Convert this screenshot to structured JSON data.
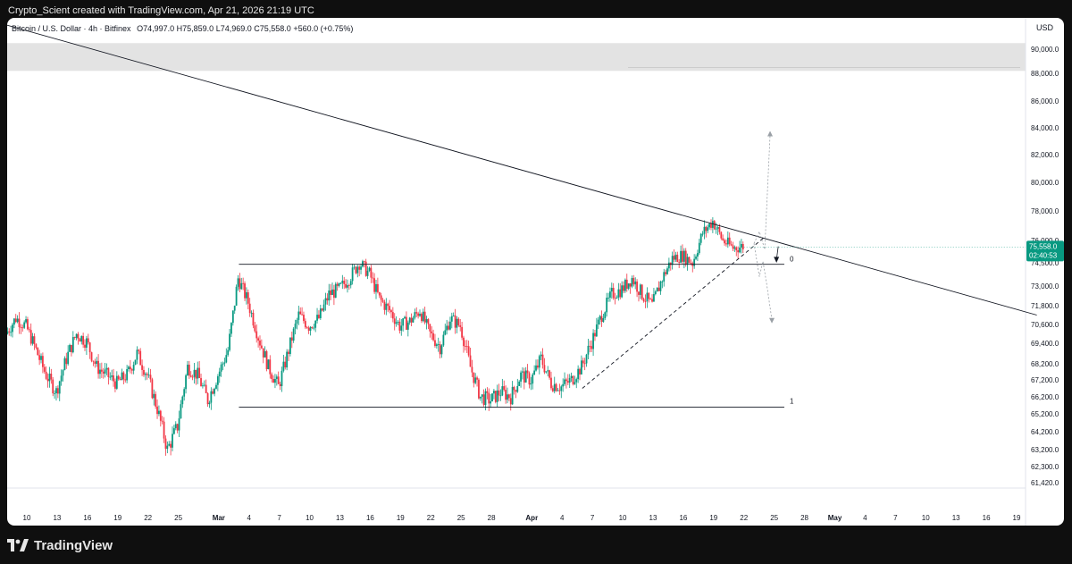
{
  "header": {
    "attribution": "Crypto_Scient created with TradingView.com, Apr 21, 2026 21:19 UTC"
  },
  "legend": {
    "symbol": "Bitcoin / U.S. Dollar · 4h · Bitfinex",
    "open": "O74,997.0",
    "high": "H75,859.0",
    "low": "L74,969.0",
    "close": "C75,558.0",
    "change": "+560.0 (+0.75%)"
  },
  "currency_label": "USD",
  "price_tag": {
    "price": "75,558.0",
    "countdown": "02:40:53",
    "color": "#089981"
  },
  "footer": {
    "brand": "TradingView"
  },
  "colors": {
    "up": "#089981",
    "down": "#f23645",
    "line": "#131722",
    "band": "#e3e3e3"
  },
  "chart_data": {
    "type": "candlestick",
    "timeframe": "4h",
    "y_ticks": [
      "90,000.0",
      "88,000.0",
      "86,000.0",
      "84,000.0",
      "82,000.0",
      "80,000.0",
      "78,000.0",
      "76,000.0",
      "74,500.0",
      "73,000.0",
      "71,800.0",
      "70,600.0",
      "69,400.0",
      "68,200.0",
      "67,200.0",
      "66,200.0",
      "65,200.0",
      "64,200.0",
      "63,200.0",
      "62,300.0",
      "61,420.0"
    ],
    "y_tick_values": [
      90000,
      88000,
      86000,
      84000,
      82000,
      80000,
      78000,
      76000,
      74500,
      73000,
      71800,
      70600,
      69400,
      68200,
      67200,
      66200,
      65200,
      64200,
      63200,
      62300,
      61420
    ],
    "x_labels": [
      {
        "text": "10",
        "day": 10
      },
      {
        "text": "13",
        "day": 13
      },
      {
        "text": "16",
        "day": 16
      },
      {
        "text": "19",
        "day": 19
      },
      {
        "text": "22",
        "day": 22
      },
      {
        "text": "25",
        "day": 25
      },
      {
        "text": "Mar",
        "day": 29,
        "bold": true
      },
      {
        "text": "4",
        "day": 32
      },
      {
        "text": "7",
        "day": 35
      },
      {
        "text": "10",
        "day": 38
      },
      {
        "text": "13",
        "day": 41
      },
      {
        "text": "16",
        "day": 44
      },
      {
        "text": "19",
        "day": 47
      },
      {
        "text": "22",
        "day": 50
      },
      {
        "text": "25",
        "day": 53
      },
      {
        "text": "28",
        "day": 56
      },
      {
        "text": "Apr",
        "day": 60,
        "bold": true
      },
      {
        "text": "4",
        "day": 63
      },
      {
        "text": "7",
        "day": 66
      },
      {
        "text": "10",
        "day": 69
      },
      {
        "text": "13",
        "day": 72
      },
      {
        "text": "16",
        "day": 75
      },
      {
        "text": "19",
        "day": 78
      },
      {
        "text": "22",
        "day": 81
      },
      {
        "text": "25",
        "day": 84
      },
      {
        "text": "28",
        "day": 87
      },
      {
        "text": "May",
        "day": 90,
        "bold": true
      },
      {
        "text": "4",
        "day": 93
      },
      {
        "text": "7",
        "day": 96
      },
      {
        "text": "10",
        "day": 99
      },
      {
        "text": "13",
        "day": 102
      },
      {
        "text": "16",
        "day": 105
      },
      {
        "text": "19",
        "day": 108
      }
    ],
    "x_domain_days": [
      8,
      110
    ],
    "price_path": [
      [
        8,
        70000
      ],
      [
        9,
        71000
      ],
      [
        10,
        70500
      ],
      [
        11,
        69000
      ],
      [
        12,
        67500
      ],
      [
        13,
        66500
      ],
      [
        14,
        68500
      ],
      [
        15,
        70000
      ],
      [
        16,
        69500
      ],
      [
        17,
        68000
      ],
      [
        18,
        67500
      ],
      [
        19,
        67000
      ],
      [
        20,
        67500
      ],
      [
        21,
        68800
      ],
      [
        22,
        67500
      ],
      [
        23,
        65500
      ],
      [
        24,
        63200
      ],
      [
        25,
        64500
      ],
      [
        26,
        68000
      ],
      [
        27,
        67500
      ],
      [
        28,
        66000
      ],
      [
        29,
        67500
      ],
      [
        30,
        69000
      ],
      [
        31,
        73500
      ],
      [
        32,
        72000
      ],
      [
        33,
        69800
      ],
      [
        34,
        68000
      ],
      [
        35,
        66800
      ],
      [
        36,
        69000
      ],
      [
        37,
        71200
      ],
      [
        38,
        70500
      ],
      [
        39,
        71000
      ],
      [
        40,
        72500
      ],
      [
        41,
        72800
      ],
      [
        42,
        73500
      ],
      [
        43,
        74500
      ],
      [
        44,
        73800
      ],
      [
        45,
        72200
      ],
      [
        46,
        71500
      ],
      [
        47,
        70500
      ],
      [
        48,
        70800
      ],
      [
        49,
        71500
      ],
      [
        50,
        70000
      ],
      [
        51,
        69200
      ],
      [
        52,
        71000
      ],
      [
        53,
        70500
      ],
      [
        54,
        68000
      ],
      [
        55,
        66200
      ],
      [
        56,
        66000
      ],
      [
        57,
        66500
      ],
      [
        58,
        66200
      ],
      [
        59,
        67500
      ],
      [
        60,
        67200
      ],
      [
        61,
        68500
      ],
      [
        62,
        67000
      ],
      [
        63,
        66800
      ],
      [
        64,
        67200
      ],
      [
        65,
        68000
      ],
      [
        66,
        69500
      ],
      [
        67,
        71200
      ],
      [
        68,
        72500
      ],
      [
        69,
        72800
      ],
      [
        70,
        73500
      ],
      [
        71,
        72500
      ],
      [
        72,
        71800
      ],
      [
        73,
        73500
      ],
      [
        74,
        74800
      ],
      [
        75,
        75000
      ],
      [
        76,
        74500
      ],
      [
        77,
        76500
      ],
      [
        78,
        77300
      ],
      [
        79,
        76000
      ],
      [
        80,
        75500
      ],
      [
        81,
        75600
      ]
    ],
    "resistance_trendline": {
      "from": [
        8,
        92000
      ],
      "to": [
        110,
        71200
      ]
    },
    "range_top": {
      "price": 74400,
      "from_day": 31,
      "to_day": 85
    },
    "range_bottom": {
      "price": 65600,
      "from_day": 31,
      "to_day": 85,
      "label": "1"
    },
    "rising_support": {
      "from": [
        65,
        66700
      ],
      "to": [
        83,
        76200
      ]
    },
    "projection_up_target": 83500,
    "projection_down_target": 70900,
    "marker_label": "0",
    "highlight_band": [
      88200,
      90500
    ]
  }
}
